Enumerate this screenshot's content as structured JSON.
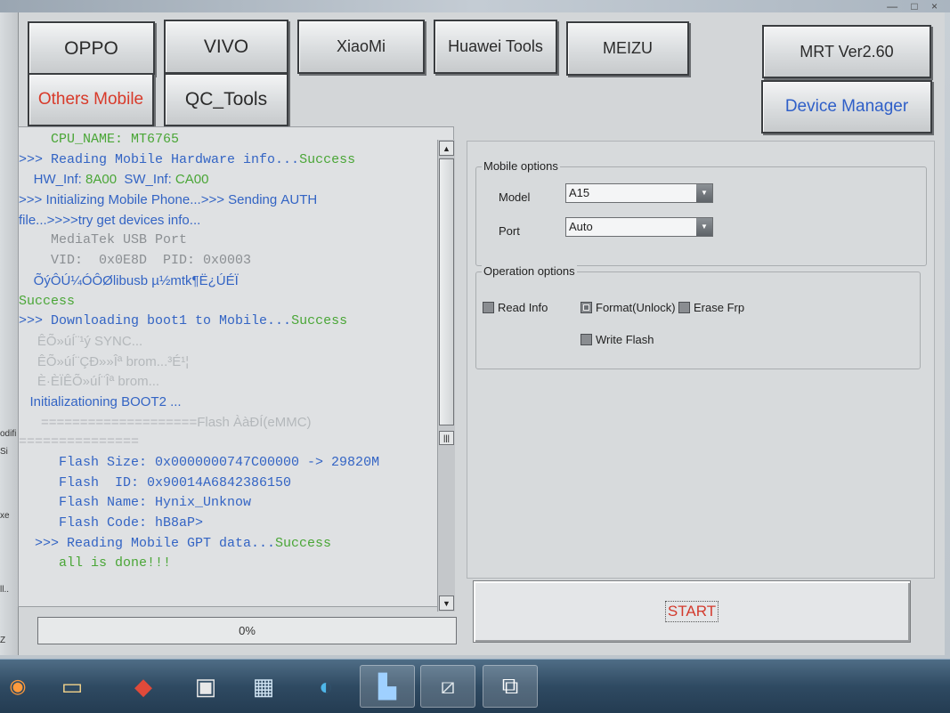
{
  "window": {
    "controls": "— □ ×"
  },
  "left_edge": {
    "snippets": [
      "odifi",
      "Si",
      "xe",
      "ll..",
      "Z"
    ]
  },
  "toolbar": {
    "oppo": "OPPO",
    "vivo": "VIVO",
    "xiaomi": "XiaoMi",
    "huawei": "Huawei Tools",
    "meizu": "MEIZU",
    "others": "Others Mobile",
    "qc_tools": "QC_Tools",
    "version": "MRT Ver2.60",
    "device_manager": "Device Manager"
  },
  "log": {
    "lines": [
      {
        "text": "    CPU_NAME: MT6765",
        "color": "green",
        "mono": true
      },
      {
        "text": ">>> Reading Mobile Hardware info...",
        "color": "blue",
        "mono": true,
        "suffix": "Success",
        "suffix_color": "green"
      },
      {
        "text": "    HW_Inf: ",
        "color": "blue",
        "mono": false,
        "suffix": "8A00",
        "suffix_color": "green",
        "mid": "  SW_Inf: ",
        "end": "CA00"
      },
      {
        "text": ">>> Initializing Mobile Phone...>>> Sending AUTH",
        "color": "blue",
        "mono": false
      },
      {
        "text": "file...>>>>try get devices info...",
        "color": "blue",
        "mono": false
      },
      {
        "text": "    MediaTek USB Port",
        "color": "gray",
        "mono": true
      },
      {
        "text": "    VID:  0x0E8D  PID: 0x0003",
        "color": "gray",
        "mono": true
      },
      {
        "text": "    ÕýÔÚ¼ÓÔØlibusb µ½mtk¶Ë¿ÚÉÏ",
        "color": "blue",
        "mono": false
      },
      {
        "text": "Success",
        "color": "green",
        "mono": true
      },
      {
        "text": ">>> Downloading boot1 to Mobile...",
        "color": "blue",
        "mono": true,
        "suffix": "Success",
        "suffix_color": "green"
      },
      {
        "text": "     ÊÕ»úÍ¨¹ý SYNC...",
        "color": "faint",
        "mono": false
      },
      {
        "text": "     ÊÕ»úÍ¨ÇÐ»»Îª brom...³É¹¦",
        "color": "faint",
        "mono": false
      },
      {
        "text": "     È·ÈÏÊÕ»úÍ¨Îª brom...",
        "color": "faint",
        "mono": false
      },
      {
        "text": "   Initializationing BOOT2 ...",
        "color": "blue",
        "mono": false
      },
      {
        "text": "      ====================Flash ÀàÐÍ(eMMC)",
        "color": "faint",
        "mono": false
      },
      {
        "text": "===============",
        "color": "faint",
        "mono": true
      },
      {
        "text": "     Flash Size: 0x0000000747C00000 -> 29820M",
        "color": "blue",
        "mono": true
      },
      {
        "text": "     Flash  ID: 0x90014A6842386150",
        "color": "blue",
        "mono": true
      },
      {
        "text": "     Flash Name: Hynix_Unknow",
        "color": "blue",
        "mono": true
      },
      {
        "text": "     Flash Code: hB8aP>",
        "color": "blue",
        "mono": true
      },
      {
        "text": "  >>> Reading Mobile GPT data...",
        "color": "blue",
        "mono": true,
        "suffix": "Success",
        "suffix_color": "green"
      },
      {
        "text": "     all is done!!!",
        "color": "green",
        "mono": true
      }
    ]
  },
  "progress": {
    "label": "0%",
    "value": 0
  },
  "mobile_options": {
    "title": "Mobile options",
    "model_label": "Model",
    "model_value": "A15",
    "port_label": "Port",
    "port_value": "Auto"
  },
  "operation_options": {
    "title": "Operation options",
    "read_info": "Read Info",
    "format_unlock": "Format(Unlock)",
    "erase_frp": "Erase Frp",
    "write_flash": "Write Flash"
  },
  "start": {
    "label": "START"
  },
  "taskbar": {
    "icons": [
      "start-orb-icon",
      "folder-icon",
      "tool-icon",
      "media-icon",
      "calc-icon",
      "edge-icon",
      "phone-tool-icon",
      "usb-icon",
      "restore-icon"
    ]
  }
}
